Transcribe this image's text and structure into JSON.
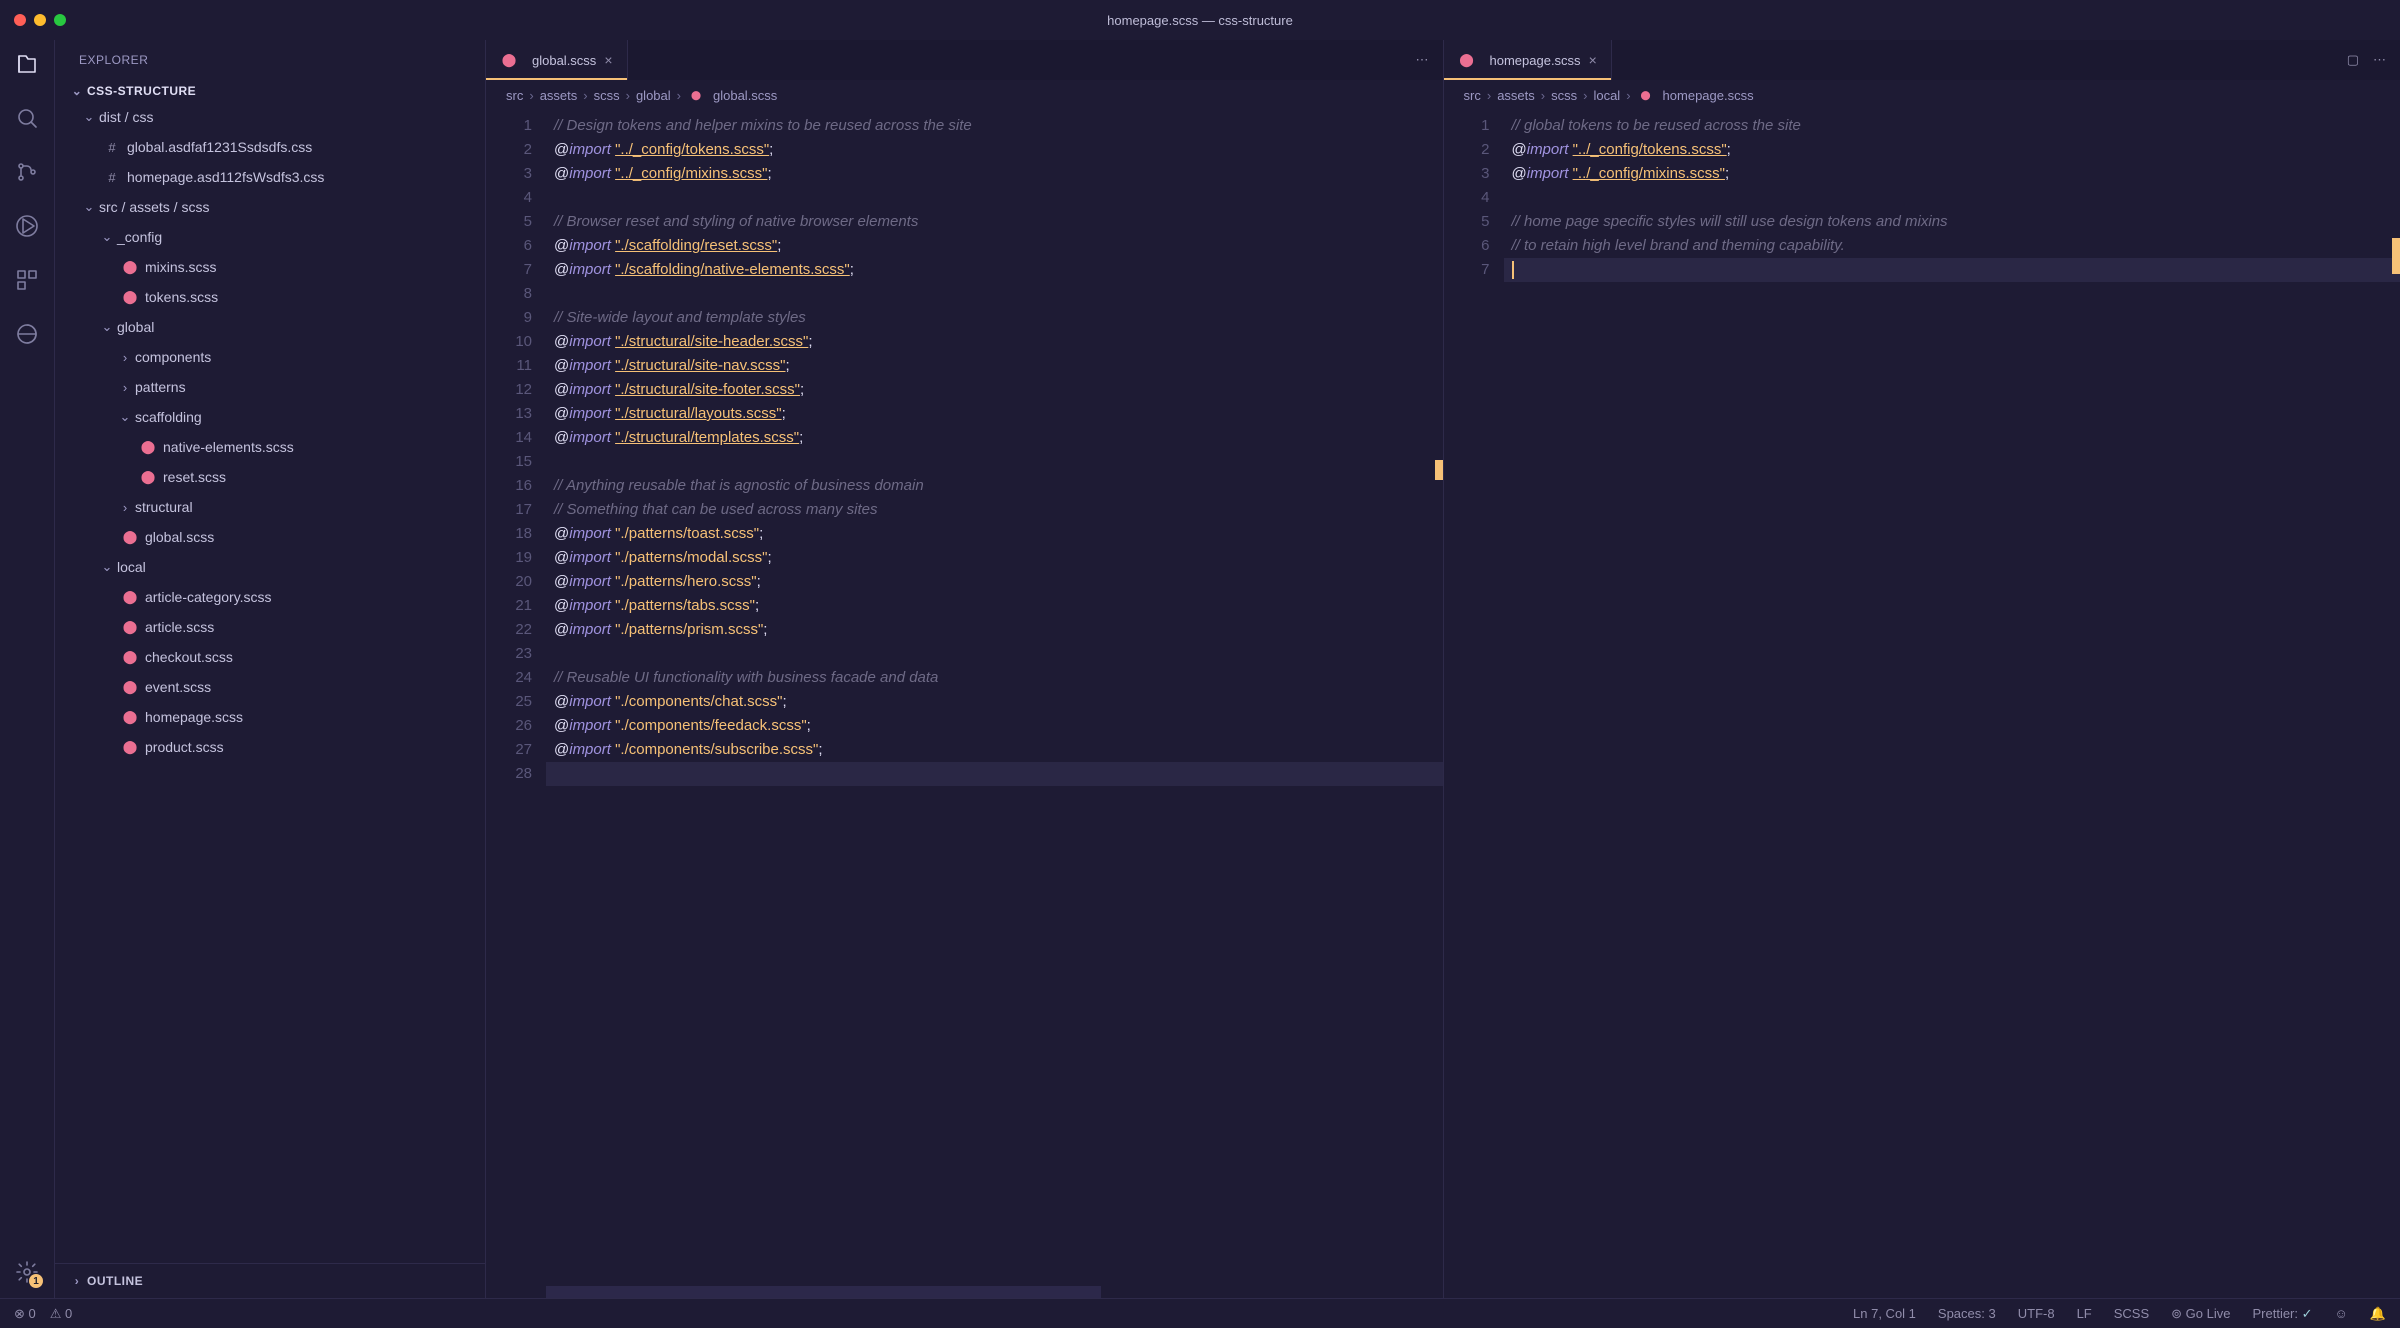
{
  "window_title": "homepage.scss — css-structure",
  "sidebar": {
    "header": "EXPLORER",
    "project": "CSS-STRUCTURE",
    "outline": "OUTLINE",
    "tree": [
      {
        "indent": 0,
        "kind": "folder",
        "open": true,
        "name": "dist / css"
      },
      {
        "indent": 1,
        "kind": "hash",
        "name": "global.asdfaf1231Ssdsdfs.css"
      },
      {
        "indent": 1,
        "kind": "hash",
        "name": "homepage.asd112fsWsdfs3.css"
      },
      {
        "indent": 0,
        "kind": "folder",
        "open": true,
        "name": "src / assets / scss"
      },
      {
        "indent": 1,
        "kind": "folder",
        "open": true,
        "name": "_config"
      },
      {
        "indent": 2,
        "kind": "scss",
        "name": "mixins.scss"
      },
      {
        "indent": 2,
        "kind": "scss",
        "name": "tokens.scss"
      },
      {
        "indent": 1,
        "kind": "folder",
        "open": true,
        "name": "global"
      },
      {
        "indent": 2,
        "kind": "folder",
        "open": false,
        "name": "components"
      },
      {
        "indent": 2,
        "kind": "folder",
        "open": false,
        "name": "patterns"
      },
      {
        "indent": 2,
        "kind": "folder",
        "open": true,
        "name": "scaffolding"
      },
      {
        "indent": 3,
        "kind": "scss",
        "name": "native-elements.scss"
      },
      {
        "indent": 3,
        "kind": "scss",
        "name": "reset.scss"
      },
      {
        "indent": 2,
        "kind": "folder",
        "open": false,
        "name": "structural"
      },
      {
        "indent": 2,
        "kind": "scss",
        "name": "global.scss"
      },
      {
        "indent": 1,
        "kind": "folder",
        "open": true,
        "name": "local"
      },
      {
        "indent": 2,
        "kind": "scss",
        "name": "article-category.scss"
      },
      {
        "indent": 2,
        "kind": "scss",
        "name": "article.scss"
      },
      {
        "indent": 2,
        "kind": "scss",
        "name": "checkout.scss"
      },
      {
        "indent": 2,
        "kind": "scss",
        "name": "event.scss"
      },
      {
        "indent": 2,
        "kind": "scss",
        "name": "homepage.scss"
      },
      {
        "indent": 2,
        "kind": "scss",
        "name": "product.scss"
      }
    ]
  },
  "editor_left": {
    "tab_name": "global.scss",
    "breadcrumb": [
      "src",
      "assets",
      "scss",
      "global",
      "global.scss"
    ],
    "lines": [
      {
        "n": 1,
        "t": "comment",
        "text": "// Design tokens and helper mixins to be reused across the site"
      },
      {
        "n": 2,
        "t": "import",
        "str": "\"../_config/tokens.scss\"",
        "u": true
      },
      {
        "n": 3,
        "t": "import",
        "str": "\"../_config/mixins.scss\"",
        "u": true
      },
      {
        "n": 4,
        "t": "blank"
      },
      {
        "n": 5,
        "t": "comment",
        "text": "// Browser reset and styling of native browser elements"
      },
      {
        "n": 6,
        "t": "import",
        "str": "\"./scaffolding/reset.scss\"",
        "u": true
      },
      {
        "n": 7,
        "t": "import",
        "str": "\"./scaffolding/native-elements.scss\"",
        "u": true
      },
      {
        "n": 8,
        "t": "blank"
      },
      {
        "n": 9,
        "t": "comment",
        "text": "// Site-wide layout and template styles"
      },
      {
        "n": 10,
        "t": "import",
        "str": "\"./structural/site-header.scss\"",
        "u": true
      },
      {
        "n": 11,
        "t": "import",
        "str": "\"./structural/site-nav.scss\"",
        "u": true
      },
      {
        "n": 12,
        "t": "import",
        "str": "\"./structural/site-footer.scss\"",
        "u": true
      },
      {
        "n": 13,
        "t": "import",
        "str": "\"./structural/layouts.scss\"",
        "u": true
      },
      {
        "n": 14,
        "t": "import",
        "str": "\"./structural/templates.scss\"",
        "u": true
      },
      {
        "n": 15,
        "t": "blank"
      },
      {
        "n": 16,
        "t": "comment",
        "text": "// Anything reusable that is agnostic of business domain"
      },
      {
        "n": 17,
        "t": "comment",
        "text": "// Something that can be used across many sites"
      },
      {
        "n": 18,
        "t": "import",
        "str": "\"./patterns/toast.scss\""
      },
      {
        "n": 19,
        "t": "import",
        "str": "\"./patterns/modal.scss\""
      },
      {
        "n": 20,
        "t": "import",
        "str": "\"./patterns/hero.scss\""
      },
      {
        "n": 21,
        "t": "import",
        "str": "\"./patterns/tabs.scss\""
      },
      {
        "n": 22,
        "t": "import",
        "str": "\"./patterns/prism.scss\""
      },
      {
        "n": 23,
        "t": "blank"
      },
      {
        "n": 24,
        "t": "comment",
        "text": "// Reusable UI functionality with business facade and data"
      },
      {
        "n": 25,
        "t": "import",
        "str": "\"./components/chat.scss\""
      },
      {
        "n": 26,
        "t": "import",
        "str": "\"./components/feedack.scss\""
      },
      {
        "n": 27,
        "t": "import",
        "str": "\"./components/subscribe.scss\""
      },
      {
        "n": 28,
        "t": "blank",
        "current": true
      }
    ]
  },
  "editor_right": {
    "tab_name": "homepage.scss",
    "breadcrumb": [
      "src",
      "assets",
      "scss",
      "local",
      "homepage.scss"
    ],
    "lines": [
      {
        "n": 1,
        "t": "comment",
        "text": "// global tokens to be reused across the site"
      },
      {
        "n": 2,
        "t": "import",
        "str": "\"../_config/tokens.scss\"",
        "u": true
      },
      {
        "n": 3,
        "t": "import",
        "str": "\"../_config/mixins.scss\"",
        "u": true
      },
      {
        "n": 4,
        "t": "blank"
      },
      {
        "n": 5,
        "t": "comment",
        "text": "// home page specific styles will still use design tokens and mixins"
      },
      {
        "n": 6,
        "t": "comment",
        "text": "// to retain high level brand and theming capability."
      },
      {
        "n": 7,
        "t": "blank",
        "current": true,
        "cursor": true
      }
    ]
  },
  "status": {
    "errors": "0",
    "warnings": "0",
    "line_col": "Ln 7, Col 1",
    "spaces": "Spaces: 3",
    "encoding": "UTF-8",
    "eol": "LF",
    "lang": "SCSS",
    "golive": "Go Live",
    "prettier": "Prettier:"
  },
  "activity_badge": "1"
}
